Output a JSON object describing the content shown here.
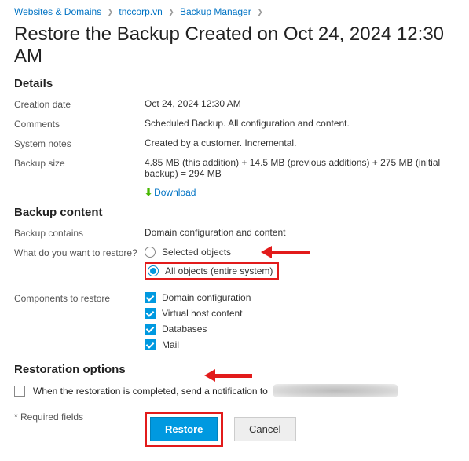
{
  "breadcrumb": {
    "a": "Websites & Domains",
    "b": "tnccorp.vn",
    "c": "Backup Manager"
  },
  "title": "Restore the Backup Created on Oct 24, 2024 12:30 AM",
  "section_details": "Details",
  "details": {
    "creation_date_label": "Creation date",
    "creation_date": "Oct 24, 2024 12:30 AM",
    "comments_label": "Comments",
    "comments": "Scheduled Backup. All configuration and content.",
    "system_notes_label": "System notes",
    "system_notes": "Created by a customer. Incremental.",
    "backup_size_label": "Backup size",
    "backup_size": "4.85 MB (this addition) + 14.5 MB (previous additions) + 275 MB (initial backup) = 294 MB",
    "download": "Download"
  },
  "section_content": "Backup content",
  "content": {
    "contains_label": "Backup contains",
    "contains": "Domain configuration and content",
    "restore_what_label": "What do you want to restore?",
    "opt_selected": "Selected objects",
    "opt_all": "All objects (entire system)",
    "components_label": "Components to restore",
    "c1": "Domain configuration",
    "c2": "Virtual host content",
    "c3": "Databases",
    "c4": "Mail"
  },
  "section_options": "Restoration options",
  "options": {
    "notif": "When the restoration is completed, send a notification to"
  },
  "footer": {
    "required": "* Required fields",
    "restore": "Restore",
    "cancel": "Cancel"
  }
}
